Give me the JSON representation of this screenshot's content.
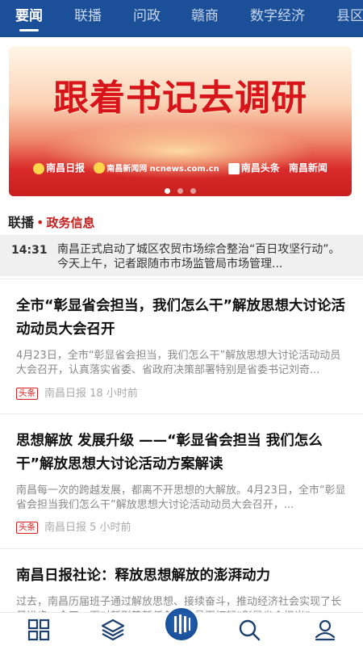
{
  "topnav": {
    "tabs": [
      {
        "label": "要闻",
        "active": true
      },
      {
        "label": "联播",
        "active": false
      },
      {
        "label": "问政",
        "active": false
      },
      {
        "label": "赣商",
        "active": false
      },
      {
        "label": "数字经济",
        "active": false
      },
      {
        "label": "县区",
        "active": false
      }
    ],
    "colors": {
      "background": "#1b4f97",
      "active": "#ffffff",
      "inactive": "#c9d7ee"
    }
  },
  "banner": {
    "headline": "跟着书记去调研",
    "logos": [
      "南昌日报",
      "南昌新闻网 ncnews.com.cn",
      "南昌头条",
      "南昌新闻"
    ],
    "slide_count": 3,
    "active_slide": 1
  },
  "section": {
    "brand": "联播",
    "separator": "•",
    "subtitle": "政务信息",
    "accent_color": "#c81e1e"
  },
  "live": {
    "time": "14:31",
    "text": "南昌正式启动了城区农贸市场综合整治“百日攻坚行动”。今天上午，记者跟随市市场监管局市场管理..."
  },
  "articles": [
    {
      "title": "全市“彰显省会担当，我们怎么干”解放思想大讨论活动动员大会召开",
      "summary": "4月23日，全市“彰显省会担当，我们怎么干”解放思想大讨论活动动员大会召开，认真落实省委、省政府决策部署特别是省委书记刘奇...",
      "tag": "头条",
      "source": "南昌日报",
      "time": "18 小时前"
    },
    {
      "title": "思想解放 发展升级 ——“彰显省会担当 我们怎么干”解放思想大讨论活动方案解读",
      "summary": "南昌每一次的跨越发展，都离不开思想的大解放。4月23日，全市“彰显省会担当我们怎么干”解放思想大讨论活动动员大会召开，...",
      "tag": "头条",
      "source": "南昌日报",
      "time": "5 小时前"
    },
    {
      "title": "南昌日报社论：释放思想解放的澎湃动力",
      "summary": "过去，南昌历届班子通过解放思想、接续奋斗，推动经济社会实现了长足进步；今天，面对新形势新任务，南昌再打起“彰显省会担当”...",
      "tag": "",
      "source": "",
      "time": ""
    }
  ],
  "bottombar": {
    "icons": [
      "grid-icon",
      "layers-icon",
      "home-logo-icon",
      "search-icon",
      "user-icon"
    ]
  }
}
